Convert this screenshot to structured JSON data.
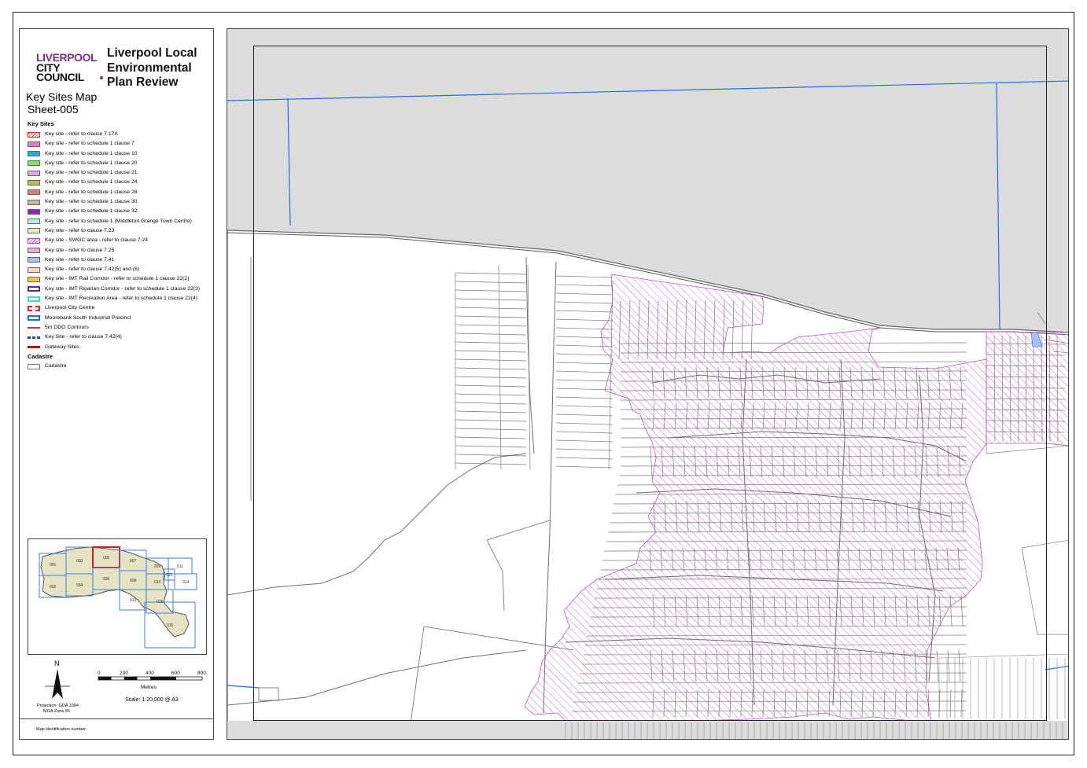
{
  "header": {
    "logo_line1": "LIVERPOOL",
    "logo_line2": "CITY",
    "logo_line3": "COUNCIL",
    "plan_title": "Liverpool Local Environmental Plan Review",
    "map_name": "Key Sites Map",
    "sheet_number": "Sheet-005"
  },
  "legend": {
    "key_sites_heading": "Key Sites",
    "items": [
      {
        "label": "Key site - refer to clause 7.17A",
        "color": "#ffffff",
        "border": "#d03030",
        "pattern": "hatch-red"
      },
      {
        "label": "Key site - refer to schedule 1 clause 7",
        "color": "#e879c8"
      },
      {
        "label": "Key site - refer to schedule 1 clause 10",
        "color": "#2aa9e0"
      },
      {
        "label": "Key site - refer to schedule 1 clause 20",
        "color": "#7de35a"
      },
      {
        "label": "Key site - refer to schedule 1 clause 21",
        "color": "#d9a6ec"
      },
      {
        "label": "Key site - refer to schedule 1 clause 24",
        "color": "#b9b957"
      },
      {
        "label": "Key site - refer to schedule 1 clause 28",
        "color": "#ee7878"
      },
      {
        "label": "Key site - refer to schedule 1 clause 30",
        "color": "#c9b597"
      },
      {
        "label": "Key site - refer to schedule 1 clause 32",
        "color": "#a218c9"
      },
      {
        "label": "Key site - refer to schedule 1 (Middleton Grange Town Centre)",
        "color": "#b9ece0"
      },
      {
        "label": "Key site - refer to clause 7.23",
        "color": "#e4ecc2"
      },
      {
        "label": "Key site - SWGC area - refer to clause 7.24",
        "color": "#ffffff",
        "border": "#c040c0",
        "pattern": "hatch-pink"
      },
      {
        "label": "Key site - refer to clause 7.25",
        "color": "#f0a6d9"
      },
      {
        "label": "Key site - refer to clause 7.41",
        "color": "#a7c2f2"
      },
      {
        "label": "Key site - refer to clause 7.42(5) and (6)",
        "color": "#f7d7c0"
      },
      {
        "label": "Key site - IMT Rail Corridor - refer to schedule 1 clause 22(2)",
        "color": "#f5c25c"
      },
      {
        "label": "Key site - IMT Riparian Corridor - refer to schedule 1 clause 22(3)",
        "color": "#ffffff",
        "border": "#5a2a9a",
        "pattern": "outline"
      },
      {
        "label": "Key site - IMT Recreation Area - refer to schedule 1 clause 22(4)",
        "color": "#ffffff",
        "border": "#3ad7e8",
        "pattern": "outline"
      },
      {
        "label": "Liverpool City Centre",
        "color": "#ffffff",
        "border": "#e02020",
        "pattern": "dashed-outline"
      },
      {
        "label": "Moorebank South Industrial Precinct",
        "color": "#ffffff",
        "border": "#1e72e0",
        "pattern": "outline"
      },
      {
        "label": "5m DDO Contours",
        "color": "#e03030",
        "pattern": "line"
      },
      {
        "label": "Key Site - refer to clause 7.42(4)",
        "color": "#1e4fa0",
        "pattern": "dash"
      },
      {
        "label": "Gateway Sites",
        "color": "#b01818",
        "pattern": "line-thick"
      }
    ],
    "cadastre_heading": "Cadastre",
    "cadastre_items": [
      {
        "label": "Cadastre",
        "color": "#ffffff",
        "border": "#777777"
      }
    ]
  },
  "inset": {
    "sheets": [
      "001",
      "002",
      "003",
      "004",
      "005",
      "006",
      "007",
      "008",
      "009",
      "010",
      "011",
      "012",
      "013",
      "014",
      "015",
      "016"
    ],
    "highlighted": "005"
  },
  "north": {
    "label": "N"
  },
  "scale": {
    "ticks": [
      "0",
      "200",
      "400",
      "600",
      "800"
    ],
    "unit": "Metres",
    "text": "Scale: 1:20,000 @ A3"
  },
  "projection": {
    "line1": "Projection: GDA 1994",
    "line2": "MGA Zone 56"
  },
  "footer": {
    "map_identification": "Map identification number:"
  },
  "colors": {
    "swgc_hatch": "#d35fd6",
    "boundary_blue": "#1f6fe0",
    "cadastre": "#777777",
    "outside_area": "#dcdcdc"
  }
}
